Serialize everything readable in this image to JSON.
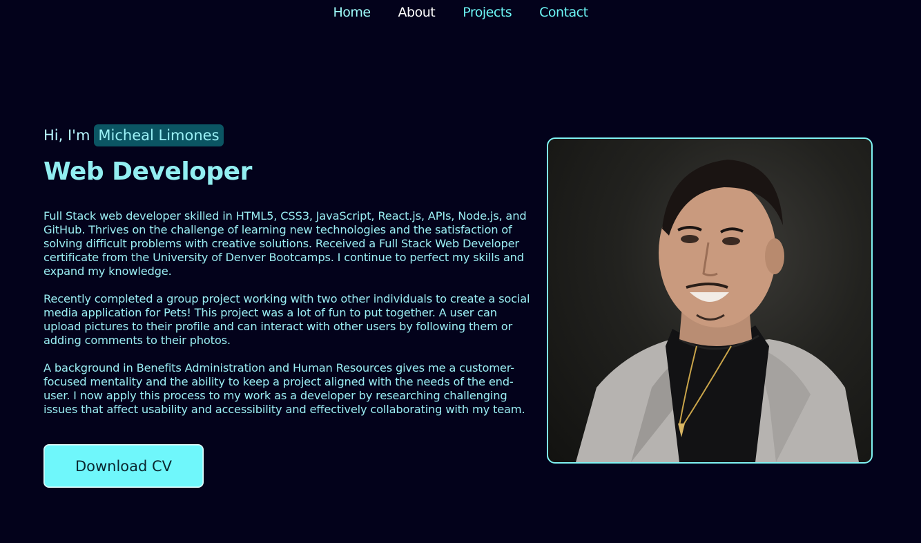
{
  "nav": {
    "items": [
      {
        "label": "Home"
      },
      {
        "label": "About"
      },
      {
        "label": "Projects"
      },
      {
        "label": "Contact"
      }
    ]
  },
  "hero": {
    "greeting": "Hi, I'm",
    "name": "Micheal Limones",
    "title": "Web Developer",
    "paragraphs": [
      "Full Stack web developer skilled in HTML5, CSS3, JavaScript, React.js, APIs, Node.js, and GitHub. Thrives on the challenge of learning new technologies and the satisfaction of solving difficult problems with creative solutions. Received a Full Stack Web Developer certificate from the University of Denver Bootcamps. I continue to perfect my skills and expand my knowledge.",
      "Recently completed a group project working with two other individuals to create a social media application for Pets! This project was a lot of fun to put together. A user can upload pictures to their profile and can interact with other users by following them or adding comments to their photos.",
      "A background in Benefits Administration and Human Resources gives me a customer-focused mentality and the ability to keep a project aligned with the needs of the end-user. I now apply this process to my work as a developer by researching challenging issues that affect usability and accessibility and effectively collaborating with my team."
    ],
    "download_label": "Download CV"
  },
  "colors": {
    "background": "#03021b",
    "accent": "#6ff7fb",
    "badge": "#0b5563"
  }
}
